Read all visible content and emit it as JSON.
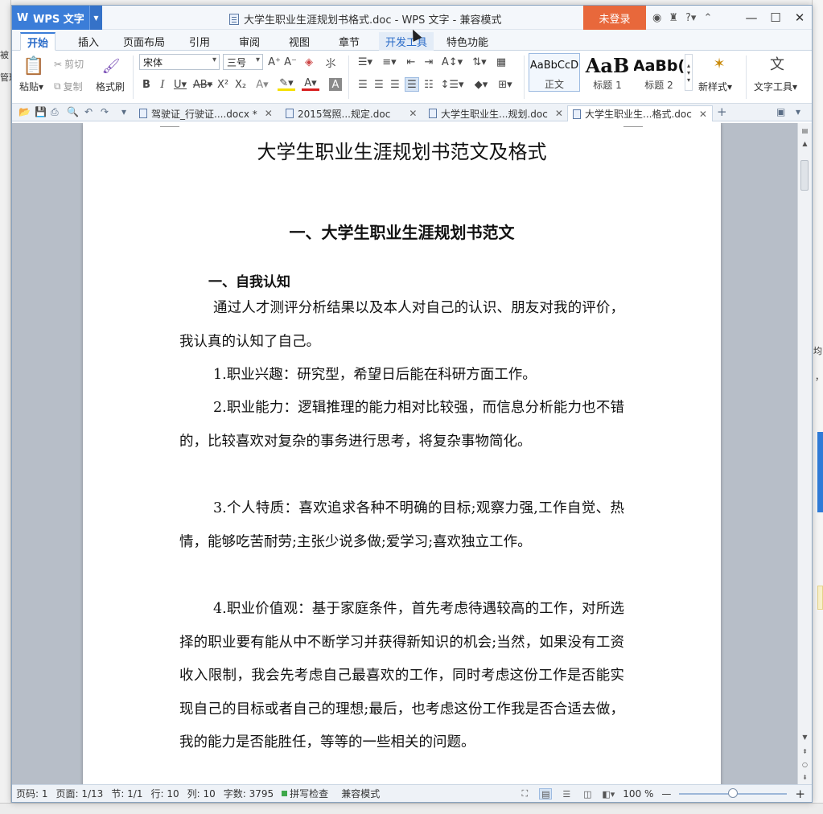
{
  "titlebar": {
    "app_name": "WPS 文字",
    "logo_letter": "W",
    "window_title": "大学生职业生涯规划书格式.doc - WPS 文字 - 兼容模式",
    "login_label": "未登录",
    "help_label": "?"
  },
  "menu": {
    "tabs": [
      "开始",
      "插入",
      "页面布局",
      "引用",
      "审阅",
      "视图",
      "章节",
      "开发工具",
      "特色功能"
    ]
  },
  "ribbon": {
    "paste": "粘贴",
    "cut": "剪切",
    "copy": "复制",
    "format_painter": "格式刷",
    "font_name": "宋体",
    "font_size": "三号",
    "styles": [
      {
        "sample": "AaBbCcD",
        "caption": "正文"
      },
      {
        "sample": "AaB",
        "caption": "标题 1"
      },
      {
        "sample": "AaBb(",
        "caption": "标题 2"
      }
    ],
    "new_style": "新样式",
    "text_tools": "文字工具"
  },
  "doctabs": [
    {
      "label": "驾驶证_行驶证....docx *"
    },
    {
      "label": "2015驾照...规定.doc"
    },
    {
      "label": "大学生职业生...规划.doc"
    },
    {
      "label": "大学生职业生...格式.doc"
    }
  ],
  "document": {
    "title": "大学生职业生涯规划书范文及格式",
    "heading2": "一、大学生职业生涯规划书范文",
    "heading3": "一、自我认知",
    "paragraphs": [
      "通过人才测评分析结果以及本人对自己的认识、朋友对我的评价，我认真的认知了自己。",
      "1.职业兴趣：研究型，希望日后能在科研方面工作。",
      "2.职业能力：逻辑推理的能力相对比较强，而信息分析能力也不错的，比较喜欢对复杂的事务进行思考，将复杂事物简化。",
      "3.个人特质：喜欢追求各种不明确的目标;观察力强,工作自觉、热情，能够吃苦耐劳;主张少说多做;爱学习;喜欢独立工作。",
      "4.职业价值观：基于家庭条件，首先考虑待遇较高的工作，对所选择的职业要有能从中不断学习并获得新知识的机会;当然，如果没有工资收入限制，我会先考虑自己最喜欢的工作，同时考虑这份工作是否能实现自己的目标或者自己的理想;最后，也考虑这份工作我是否合适去做，我的能力是否能胜任，等等的一些相关的问题。"
    ]
  },
  "status": {
    "page_code": "页码: 1",
    "pages": "页面: 1/13",
    "section": "节: 1/1",
    "row": "行: 10",
    "col": "列: 10",
    "words": "字数: 3795",
    "spell": "拼写检查",
    "compat": "兼容模式",
    "zoom": "100 %",
    "zoom_level": 0.5
  },
  "backdrop": {
    "left_texts": [
      "被",
      "管理"
    ],
    "right_texts": [
      "均",
      "，"
    ]
  }
}
